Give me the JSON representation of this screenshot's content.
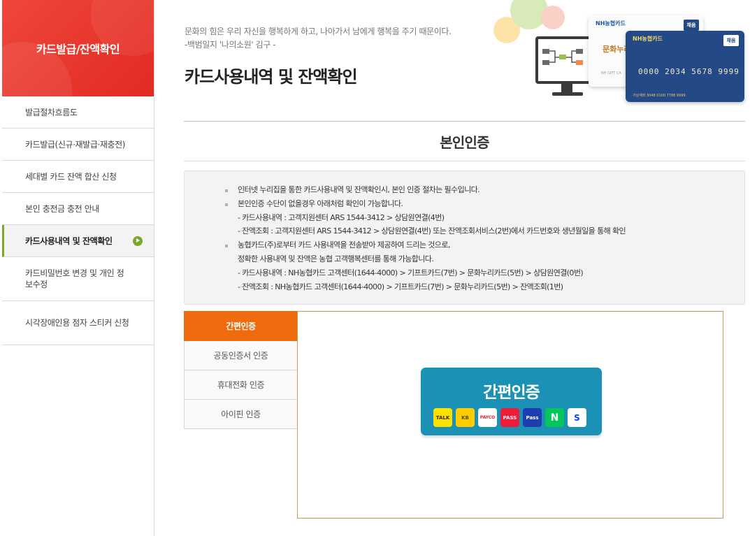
{
  "sidebar": {
    "title": "카드발급/잔액확인",
    "items": [
      {
        "label": "발급절차흐름도",
        "active": false
      },
      {
        "label": "카드발급(신규·재발급·재충전)",
        "active": false
      },
      {
        "label": "세대별 카드 잔액 합산 신청",
        "active": false
      },
      {
        "label": "본인 충전금 충전 안내",
        "active": false
      },
      {
        "label": "카드사용내역 및 잔액확인",
        "active": true
      },
      {
        "label": "카드비밀번호 변경 및 개인 정보수정",
        "active": false
      },
      {
        "label": "시각장애인용 점자 스티커 신청",
        "active": false
      }
    ]
  },
  "header": {
    "quote_line1": "문화의 힘은 우리 자신을 행복하게 하고, 나아가서 남에게 행복을 주기 때문이다.",
    "quote_line2": "-백범일지 '나의소원' 김구 -",
    "title": "카드사용내역 및 잔액확인"
  },
  "cards": {
    "back_brand": "NH농협카드",
    "back_text": "문화누리",
    "back_sub": "NH GIFT CA",
    "front_brand": "NH농협카드",
    "front_badge": "채움",
    "back_badge": "채움",
    "front_number": "0000 2034 5678 9999",
    "front_footer": "가상계좌 3048 0100 7788 9999"
  },
  "section": {
    "title": "본인인증"
  },
  "notice": {
    "lines": [
      {
        "bullet": true,
        "text": "인터넷 누리집을 통한 카드사용내역 및 잔액확인시, 본인 인증 절차는 필수입니다."
      },
      {
        "bullet": true,
        "text": "본인인증 수단이 없을경우 아래처럼 확인이 가능합니다."
      },
      {
        "bullet": false,
        "text": "- 카드사용내역 : 고객지원센터 ARS 1544-3412 > 상담원연결(4번)"
      },
      {
        "bullet": false,
        "text": "- 잔액조회 : 고객지원센터 ARS 1544-3412 > 상담원연결(4번) 또는 잔액조회서비스(2번)에서 카드번호와 생년월일을 통해 확인"
      },
      {
        "bullet": true,
        "text": "농협카드(주)로부터 카드 사용내역을 전송받아 제공하여 드리는 것으로,"
      },
      {
        "bullet": false,
        "text": "정확한 사용내역 및 잔액은 농협 고객행복센터를 통해 가능합니다."
      },
      {
        "bullet": false,
        "text": "- 카드사용내역 : NH농협카드 고객센터(1644-4000) > 기프트카드(7번) > 문화누리카드(5번) > 상담원연결(0번)"
      },
      {
        "bullet": false,
        "text": "- 잔액조회 : NH농협카드 고객센터(1644-4000) > 기프트카드(7번) > 문화누리카드(5번) > 잔액조회(1번)"
      }
    ]
  },
  "tabs": [
    {
      "label": "간편인증",
      "active": true
    },
    {
      "label": "공동인증서 인증",
      "active": false
    },
    {
      "label": "휴대전화 인증",
      "active": false
    },
    {
      "label": "아이핀 인증",
      "active": false
    }
  ],
  "auth_button": {
    "label": "간편인증",
    "providers": [
      {
        "name": "kakao-talk-icon",
        "text": "TALK",
        "bg": "#fae100",
        "fg": "#3b1e1e"
      },
      {
        "name": "kb-icon",
        "text": "KB",
        "bg": "#ffcc00",
        "fg": "#5a4a1a"
      },
      {
        "name": "payco-icon",
        "text": "PAYCO",
        "bg": "#ffffff",
        "fg": "#e6212b"
      },
      {
        "name": "pass-icon",
        "text": "PASS",
        "bg": "#ed1c3a",
        "fg": "#ffffff"
      },
      {
        "name": "samsung-pass-icon",
        "text": "Pass",
        "bg": "#1e3eaf",
        "fg": "#ffffff"
      },
      {
        "name": "naver-icon",
        "text": "N",
        "bg": "#03c75a",
        "fg": "#ffffff"
      },
      {
        "name": "shinhan-icon",
        "text": "S",
        "bg": "#ffffff",
        "fg": "#0046ff"
      }
    ]
  },
  "colors": {
    "sidebar_header": "#e22a22",
    "active_tab": "#f06b0d",
    "auth_button": "#1b92b5",
    "active_marker": "#7ba82e"
  }
}
